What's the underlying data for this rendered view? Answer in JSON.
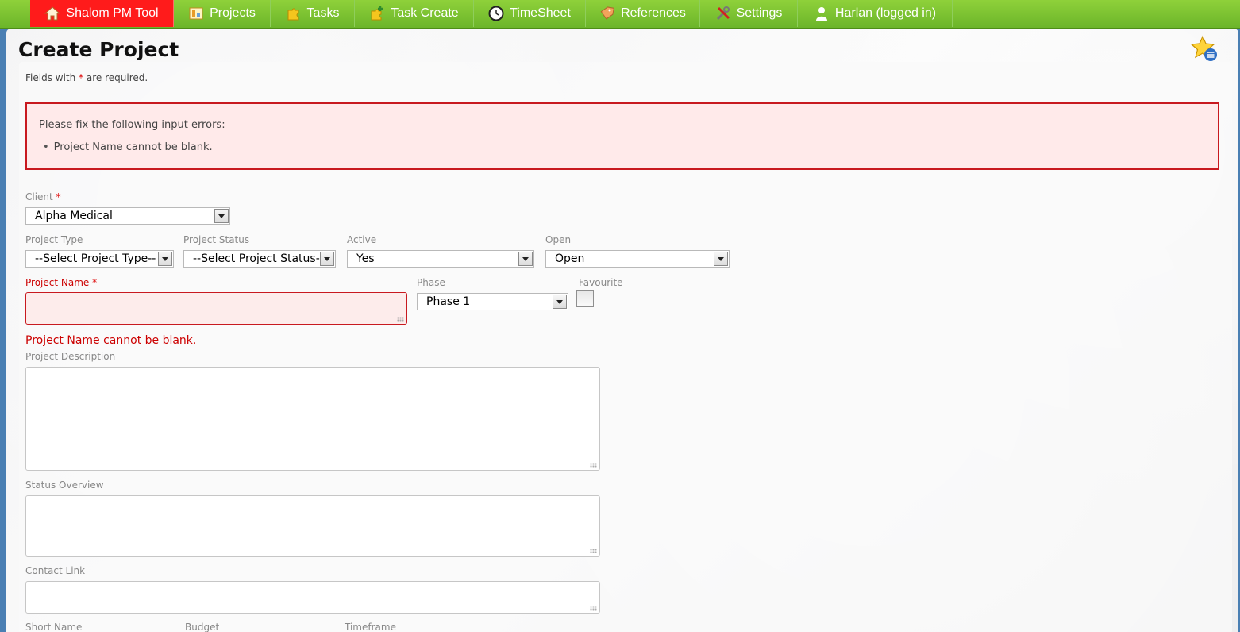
{
  "nav": {
    "items": [
      {
        "label": "Shalom PM Tool",
        "icon": "home-icon"
      },
      {
        "label": "Projects",
        "icon": "projects-icon"
      },
      {
        "label": "Tasks",
        "icon": "puzzle-icon"
      },
      {
        "label": "Task Create",
        "icon": "puzzle-add-icon"
      },
      {
        "label": "TimeSheet",
        "icon": "clock-icon"
      },
      {
        "label": "References",
        "icon": "tag-icon"
      },
      {
        "label": "Settings",
        "icon": "tools-icon"
      },
      {
        "label": "Harlan (logged in)",
        "icon": "user-icon"
      }
    ],
    "active_color": "#ff1b1b",
    "bar_color": "#7cc331"
  },
  "page": {
    "title": "Create Project",
    "required_note_pre": "Fields with ",
    "required_star": "*",
    "required_note_post": " are required."
  },
  "errors": {
    "title": "Please fix the following input errors:",
    "items": [
      "Project Name cannot be blank."
    ]
  },
  "form": {
    "client": {
      "label": "Client",
      "required": "*",
      "value": "Alpha Medical"
    },
    "project_type": {
      "label": "Project Type",
      "value": "--Select Project Type--"
    },
    "project_status": {
      "label": "Project Status",
      "value": "--Select Project Status--"
    },
    "active": {
      "label": "Active",
      "value": "Yes"
    },
    "open": {
      "label": "Open",
      "value": "Open"
    },
    "project_name": {
      "label": "Project Name",
      "required": "*",
      "value": "",
      "error": "Project Name cannot be blank."
    },
    "phase": {
      "label": "Phase",
      "value": "Phase 1"
    },
    "favourite": {
      "label": "Favourite",
      "checked": false
    },
    "project_description": {
      "label": "Project Description",
      "value": ""
    },
    "status_overview": {
      "label": "Status Overview",
      "value": ""
    },
    "contact_link": {
      "label": "Contact Link",
      "value": ""
    },
    "short_name": {
      "label": "Short Name"
    },
    "budget": {
      "label": "Budget"
    },
    "timeframe": {
      "label": "Timeframe"
    }
  }
}
